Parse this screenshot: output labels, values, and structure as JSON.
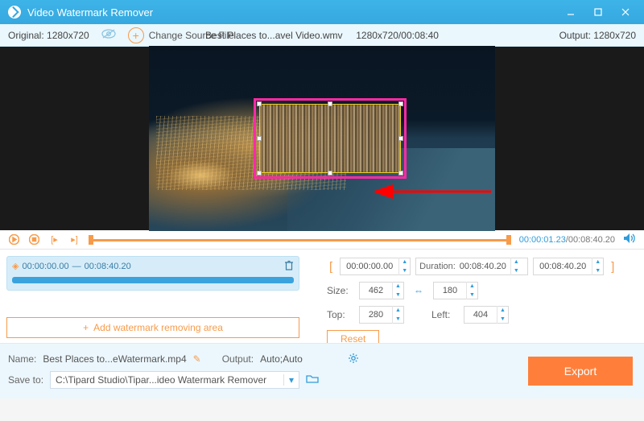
{
  "titlebar": {
    "title": "Video Watermark Remover"
  },
  "toolbar": {
    "original_label": "Original:  1280x720",
    "change_source": "Change Source File",
    "filename": "Best Places to...avel Video.wmv",
    "resolution_time": "1280x720/00:08:40",
    "output_label": "Output:  1280x720"
  },
  "playback": {
    "current": "00:00:01.23",
    "total": "/00:08:40.20"
  },
  "segment": {
    "start": "00:00:00.00",
    "sep": "—",
    "end": "00:08:40.20"
  },
  "add_area_label": "Add watermark removing area",
  "controls": {
    "time_start": "00:00:00.00",
    "duration_label": "Duration:",
    "duration_value": "00:08:40.20",
    "time_end": "00:08:40.20",
    "size_label": "Size:",
    "size_w": "462",
    "size_h": "180",
    "top_label": "Top:",
    "top_val": "280",
    "left_label": "Left:",
    "left_val": "404",
    "reset": "Reset"
  },
  "bottom": {
    "name_label": "Name:",
    "name_value": "Best Places to...eWatermark.mp4",
    "output_label": "Output:",
    "output_value": "Auto;Auto",
    "saveto_label": "Save to:",
    "saveto_value": "C:\\Tipard Studio\\Tipar...ideo Watermark Remover",
    "export": "Export"
  }
}
